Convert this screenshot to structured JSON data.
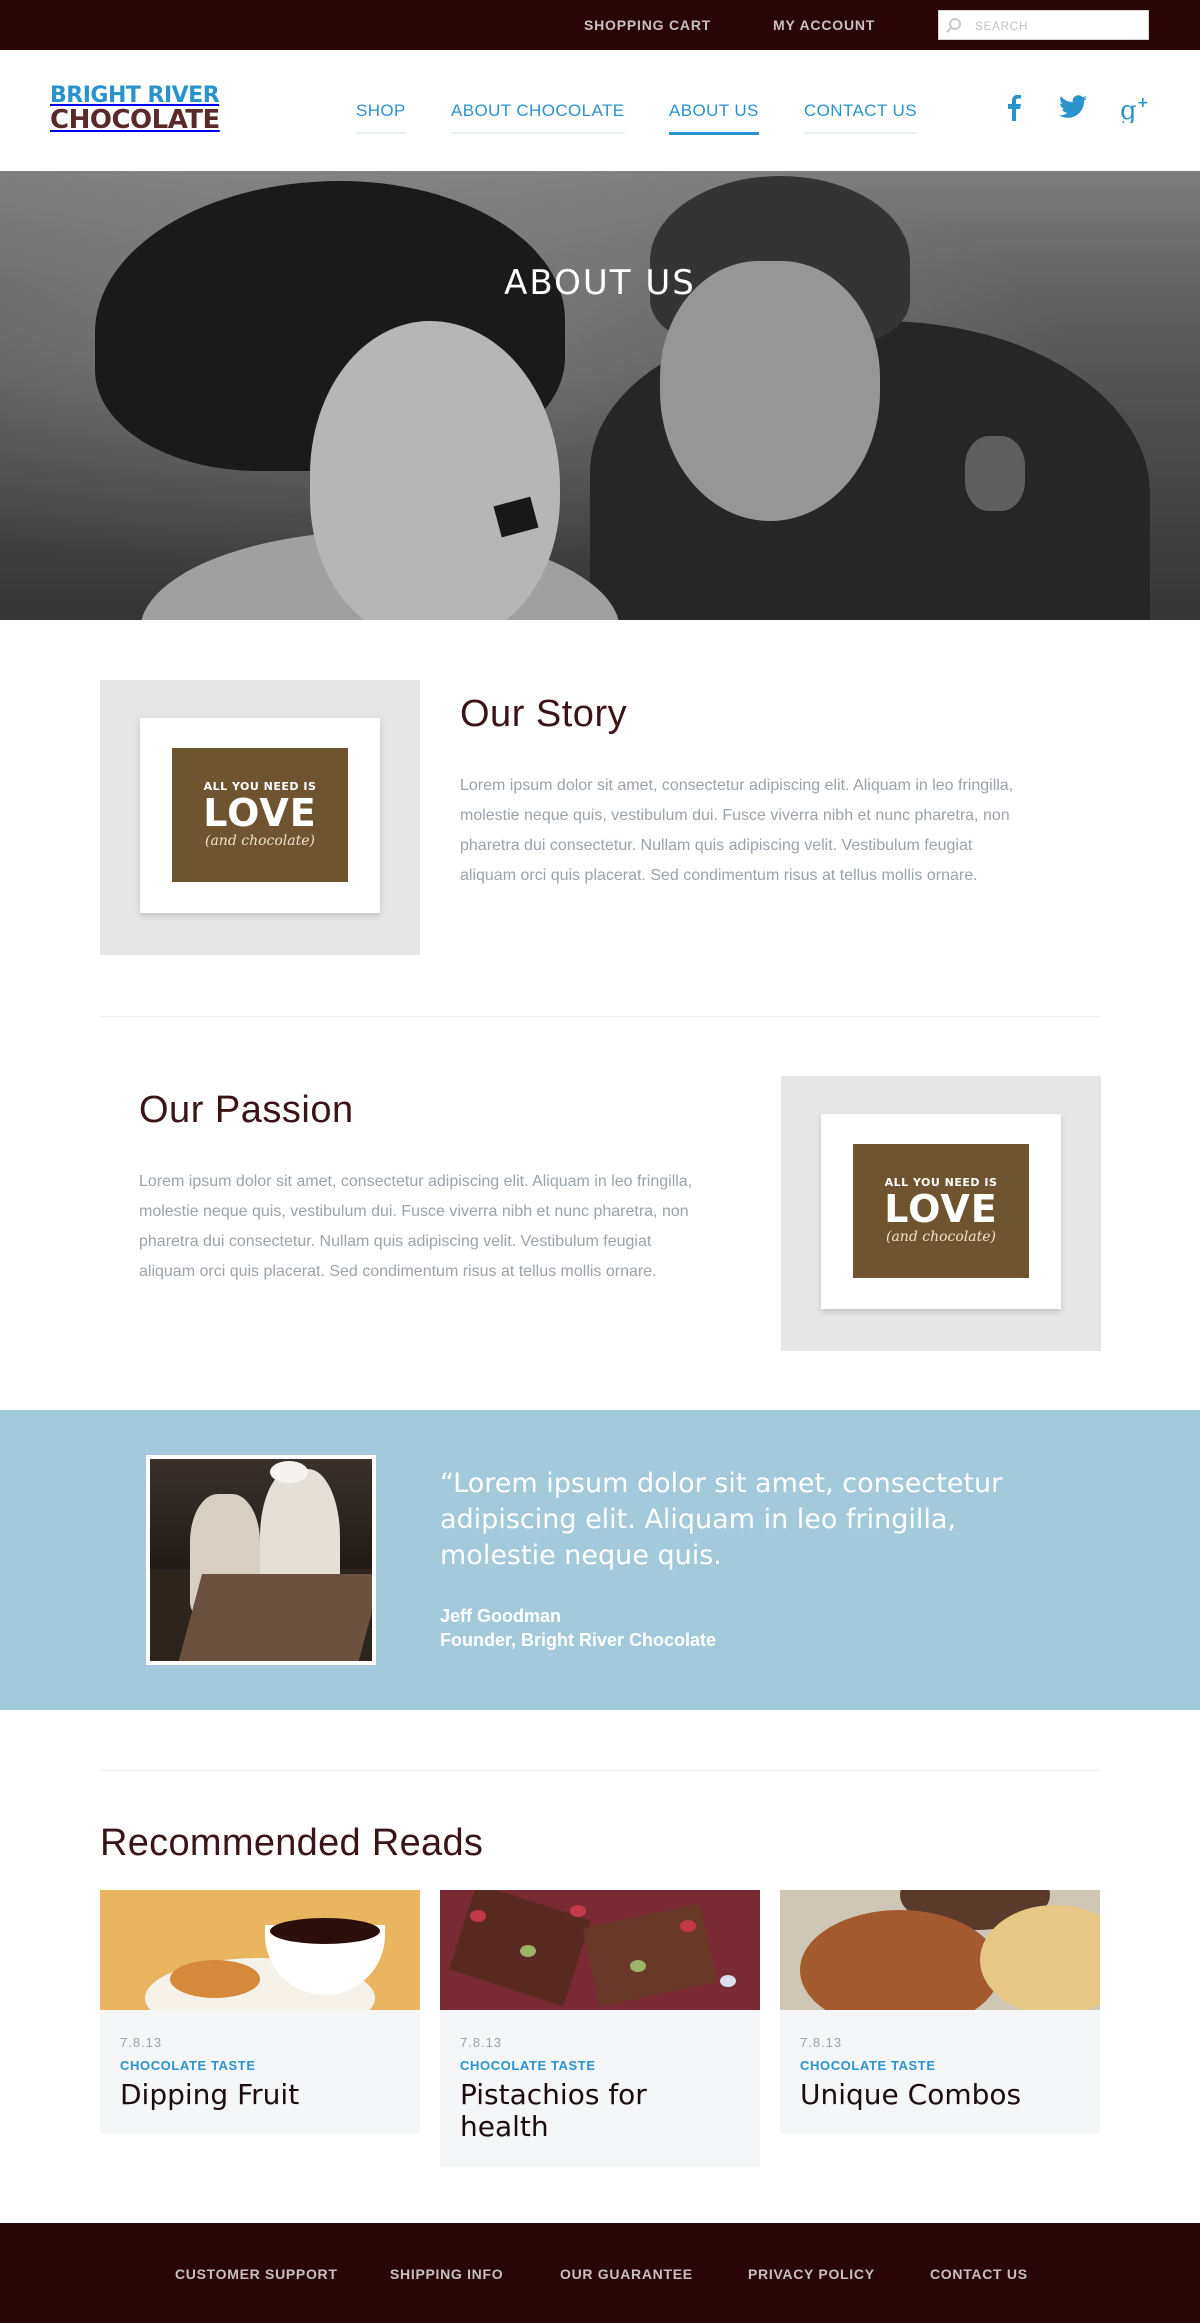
{
  "topbar": {
    "shopping_cart": "SHOPPING CART",
    "my_account": "MY ACCOUNT",
    "search_placeholder": "SEARCH"
  },
  "header": {
    "logo_line1": "BRIGHT RIVER",
    "logo_line2": "CHOCOLATE",
    "nav": [
      {
        "label": "SHOP",
        "active": false
      },
      {
        "label": "ABOUT CHOCOLATE",
        "active": false
      },
      {
        "label": "ABOUT US",
        "active": true
      },
      {
        "label": "CONTACT US",
        "active": false
      }
    ],
    "social_icons": [
      "facebook-icon",
      "twitter-icon",
      "google-plus-icon"
    ]
  },
  "hero": {
    "title": "ABOUT US"
  },
  "print": {
    "line1": "ALL YOU NEED IS",
    "line2": "LOVE",
    "line3": "(and chocolate)"
  },
  "story": {
    "title": "Our Story",
    "body": "Lorem ipsum dolor sit amet, consectetur adipiscing elit. Aliquam in leo fringilla, molestie neque quis, vestibulum dui. Fusce viverra nibh et nunc pharetra, non pharetra dui consectetur. Nullam quis adipiscing velit. Vestibulum feugiat aliquam orci quis placerat. Sed condimentum risus at tellus mollis ornare."
  },
  "passion": {
    "title": "Our Passion",
    "body": "Lorem ipsum dolor sit amet, consectetur adipiscing elit. Aliquam in leo fringilla, molestie neque quis, vestibulum dui. Fusce viverra nibh et nunc pharetra, non pharetra dui consectetur. Nullam quis adipiscing velit. Vestibulum feugiat aliquam orci quis placerat. Sed condimentum risus at tellus mollis ornare."
  },
  "testimonial": {
    "quote": "“Lorem ipsum dolor sit amet, consectetur adipiscing elit. Aliquam in leo fringilla, molestie neque quis.",
    "author_name": "Jeff Goodman",
    "author_title": "Founder, Bright River Chocolate"
  },
  "reads": {
    "title": "Recommended Reads",
    "cards": [
      {
        "date": "7.8.13",
        "category": "CHOCOLATE TASTE",
        "title": "Dipping Fruit"
      },
      {
        "date": "7.8.13",
        "category": "CHOCOLATE TASTE",
        "title": "Pistachios for health"
      },
      {
        "date": "7.8.13",
        "category": "CHOCOLATE TASTE",
        "title": "Unique Combos"
      }
    ]
  },
  "footer": {
    "links": [
      "CUSTOMER SUPPORT",
      "SHIPPING INFO",
      "OUR GUARANTEE",
      "PRIVACY POLICY",
      "CONTACT US"
    ]
  },
  "colors": {
    "brand_dark": "#2a0508",
    "accent_blue": "#2a93cc",
    "testimonial_bg": "#a2cadb",
    "body_text": "#9aa3ab"
  }
}
